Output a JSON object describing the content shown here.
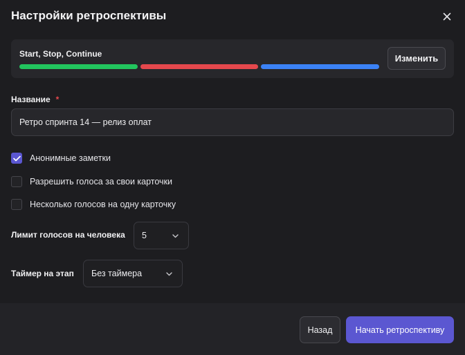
{
  "dialog": {
    "title": "Настройки ретроспективы",
    "close_icon": "close-icon"
  },
  "template": {
    "name": "Start, Stop, Continue",
    "columns_colors": [
      "#22c55e",
      "#e5484d",
      "#3b82f6"
    ],
    "change_label": "Изменить"
  },
  "name_field": {
    "label": "Название",
    "required_mark": "*",
    "value": "Ретро спринта 14 — релиз оплат"
  },
  "options": [
    {
      "label": "Анонимные заметки",
      "checked": true
    },
    {
      "label": "Разрешить голоса за свои карточки",
      "checked": false
    },
    {
      "label": "Несколько голосов на одну карточку",
      "checked": false
    }
  ],
  "vote_limit": {
    "label": "Лимит голосов на человека",
    "value": "5"
  },
  "timer": {
    "label": "Таймер на этап",
    "value": "Без таймера"
  },
  "footer": {
    "back_label": "Назад",
    "start_label": "Начать ретроспективу"
  },
  "colors": {
    "accent": "#5b57d1",
    "background": "#1d1d20",
    "required": "#e5484d"
  }
}
